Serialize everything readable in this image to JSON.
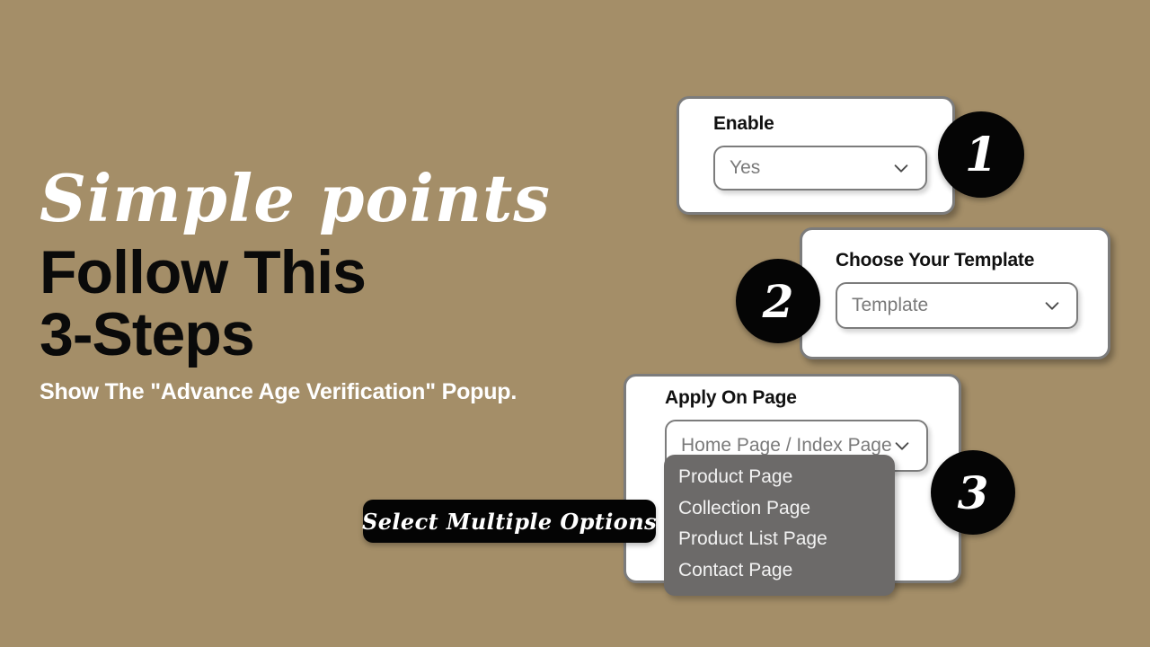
{
  "theme": {
    "background": "#a48e68",
    "card_bg": "#ffffff",
    "card_border": "#7c7c7c",
    "badge_bg": "#050505",
    "badge_text": "#ffffff",
    "option_list_bg": "#6c6a69",
    "option_text": "#f2f2f2",
    "placeholder_text": "#7a7a7a",
    "heading_dark": "#0a0a0a",
    "heading_light": "#ffffff"
  },
  "promo": {
    "script_line": "Simple points",
    "headline_line1": "Follow This",
    "headline_line2": "3-Steps",
    "subtitle": "Show The \"Advance Age Verification\" Popup."
  },
  "pill": {
    "label": "Select Multiple Options"
  },
  "steps": [
    {
      "number": "1"
    },
    {
      "number": "2"
    },
    {
      "number": "3"
    }
  ],
  "cards": {
    "enable": {
      "title": "Enable",
      "select": {
        "value": "Yes",
        "placeholder": "Yes",
        "chevron_icon": "chevron-down-icon"
      }
    },
    "template": {
      "title": "Choose Your Template",
      "select": {
        "value": "Template",
        "placeholder": "Template",
        "chevron_icon": "chevron-down-icon"
      }
    },
    "apply": {
      "title": "Apply On Page",
      "select": {
        "value": "Home Page / Index Page",
        "placeholder": "Home Page / Index Page",
        "chevron_icon": "chevron-down-icon"
      },
      "options": [
        "Product Page",
        "Collection Page",
        "Product List Page",
        "Contact Page"
      ]
    }
  }
}
